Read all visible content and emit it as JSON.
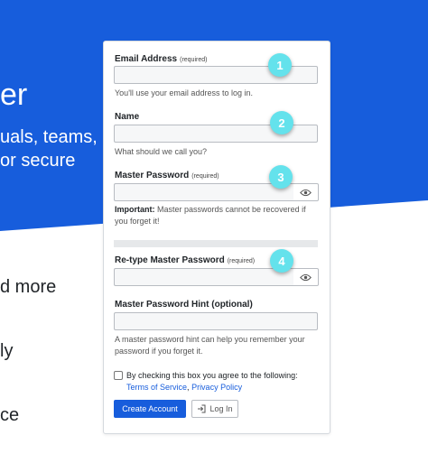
{
  "background": {
    "hero_line_1": "er",
    "hero_line_2": "uals, teams,",
    "hero_line_3": "or secure",
    "feature_1": "d more",
    "feature_2": "ly",
    "feature_3": "ce"
  },
  "form": {
    "email": {
      "label": "Email Address",
      "required": "(required)",
      "value": "",
      "hint": "You'll use your email address to log in."
    },
    "name": {
      "label": "Name",
      "value": "",
      "hint": "What should we call you?"
    },
    "master_password": {
      "label": "Master Password",
      "required": "(required)",
      "value": "",
      "hint_bold": "Important:",
      "hint": " Master passwords cannot be recovered if you forget it!"
    },
    "retype_password": {
      "label": "Re-type Master Password",
      "required": "(required)",
      "value": ""
    },
    "password_hint": {
      "label": "Master Password Hint (optional)",
      "value": "",
      "hint": "A master password hint can help you remember your password if you forget it."
    },
    "agreement": {
      "text": "By checking this box you agree to the following:",
      "terms_link": "Terms of Service",
      "separator": ",",
      "privacy_link": "Privacy Policy",
      "checked": false
    },
    "create_button": "Create Account",
    "login_button": "Log In"
  },
  "callouts": [
    "1",
    "2",
    "3",
    "4"
  ],
  "colors": {
    "brand": "#175ddc",
    "callout": "#64e2ec"
  },
  "icons": {
    "show_password": "eye-icon",
    "login": "sign-in-icon"
  }
}
